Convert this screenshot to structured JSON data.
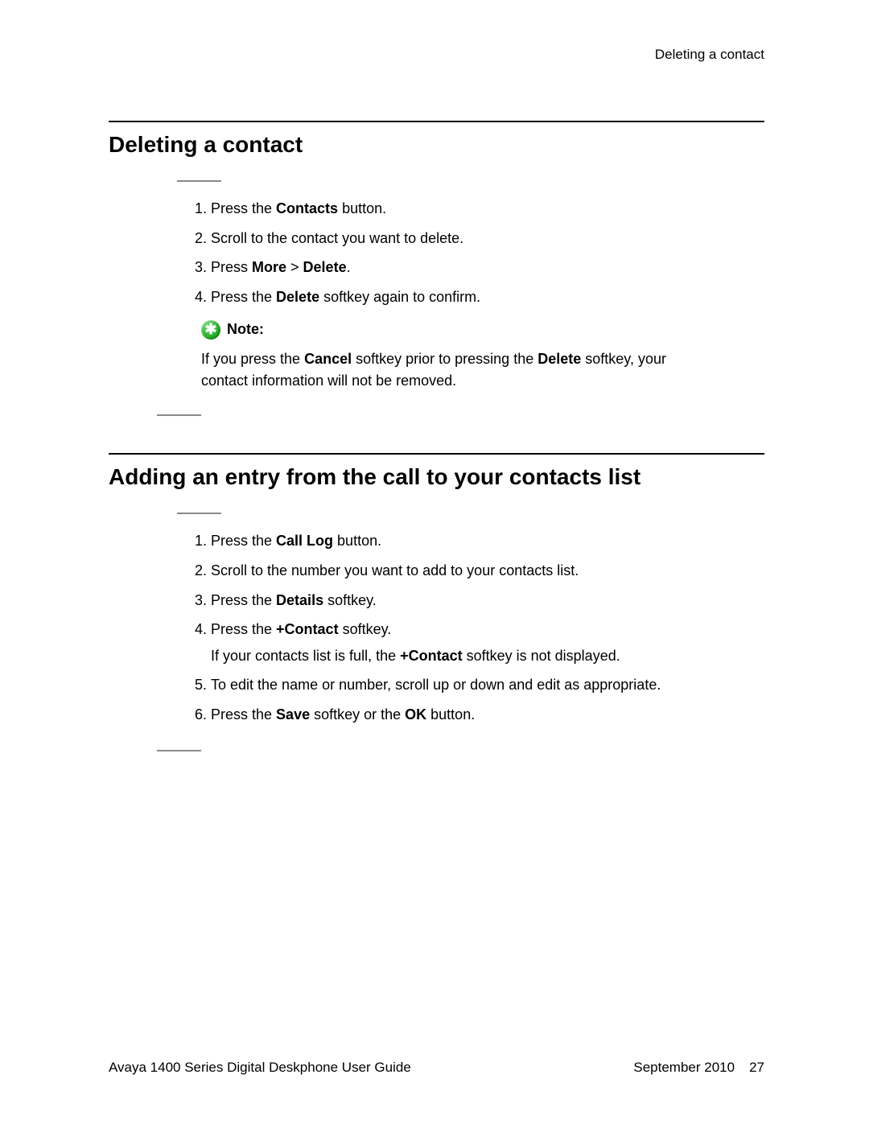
{
  "running_header": "Deleting a contact",
  "section1": {
    "title": "Deleting a contact",
    "steps": [
      {
        "pre": "Press the ",
        "b1": "Contacts",
        "post": " button."
      },
      {
        "plain": "Scroll to the contact you want to delete."
      },
      {
        "pre": "Press ",
        "b1": "More",
        "mid": " > ",
        "b2": "Delete",
        "post": "."
      },
      {
        "pre": "Press the ",
        "b1": "Delete",
        "post": " softkey again to confirm."
      }
    ],
    "note": {
      "label": "Note:",
      "pre": "If you press the ",
      "b1": "Cancel",
      "mid": " softkey prior to pressing the ",
      "b2": "Delete",
      "post": " softkey, your contact information will not be removed."
    }
  },
  "section2": {
    "title": "Adding an entry from the call to your contacts list",
    "steps": [
      {
        "pre": "Press the ",
        "b1": "Call Log",
        "post": " button."
      },
      {
        "plain": "Scroll to the number you want to add to your contacts list."
      },
      {
        "pre": "Press the ",
        "b1": "Details",
        "post": " softkey."
      },
      {
        "pre": "Press the ",
        "b1": "+Contact",
        "post": " softkey.",
        "sub_pre": "If your contacts list is full, the ",
        "sub_b1": "+Contact",
        "sub_post": " softkey is not displayed."
      },
      {
        "plain": "To edit the name or number, scroll up or down and edit as appropriate."
      },
      {
        "pre": "Press the ",
        "b1": "Save",
        "mid": " softkey or the ",
        "b2": "OK",
        "post": " button."
      }
    ]
  },
  "footer": {
    "left": "Avaya 1400 Series Digital Deskphone User Guide",
    "date": "September 2010",
    "page": "27"
  }
}
